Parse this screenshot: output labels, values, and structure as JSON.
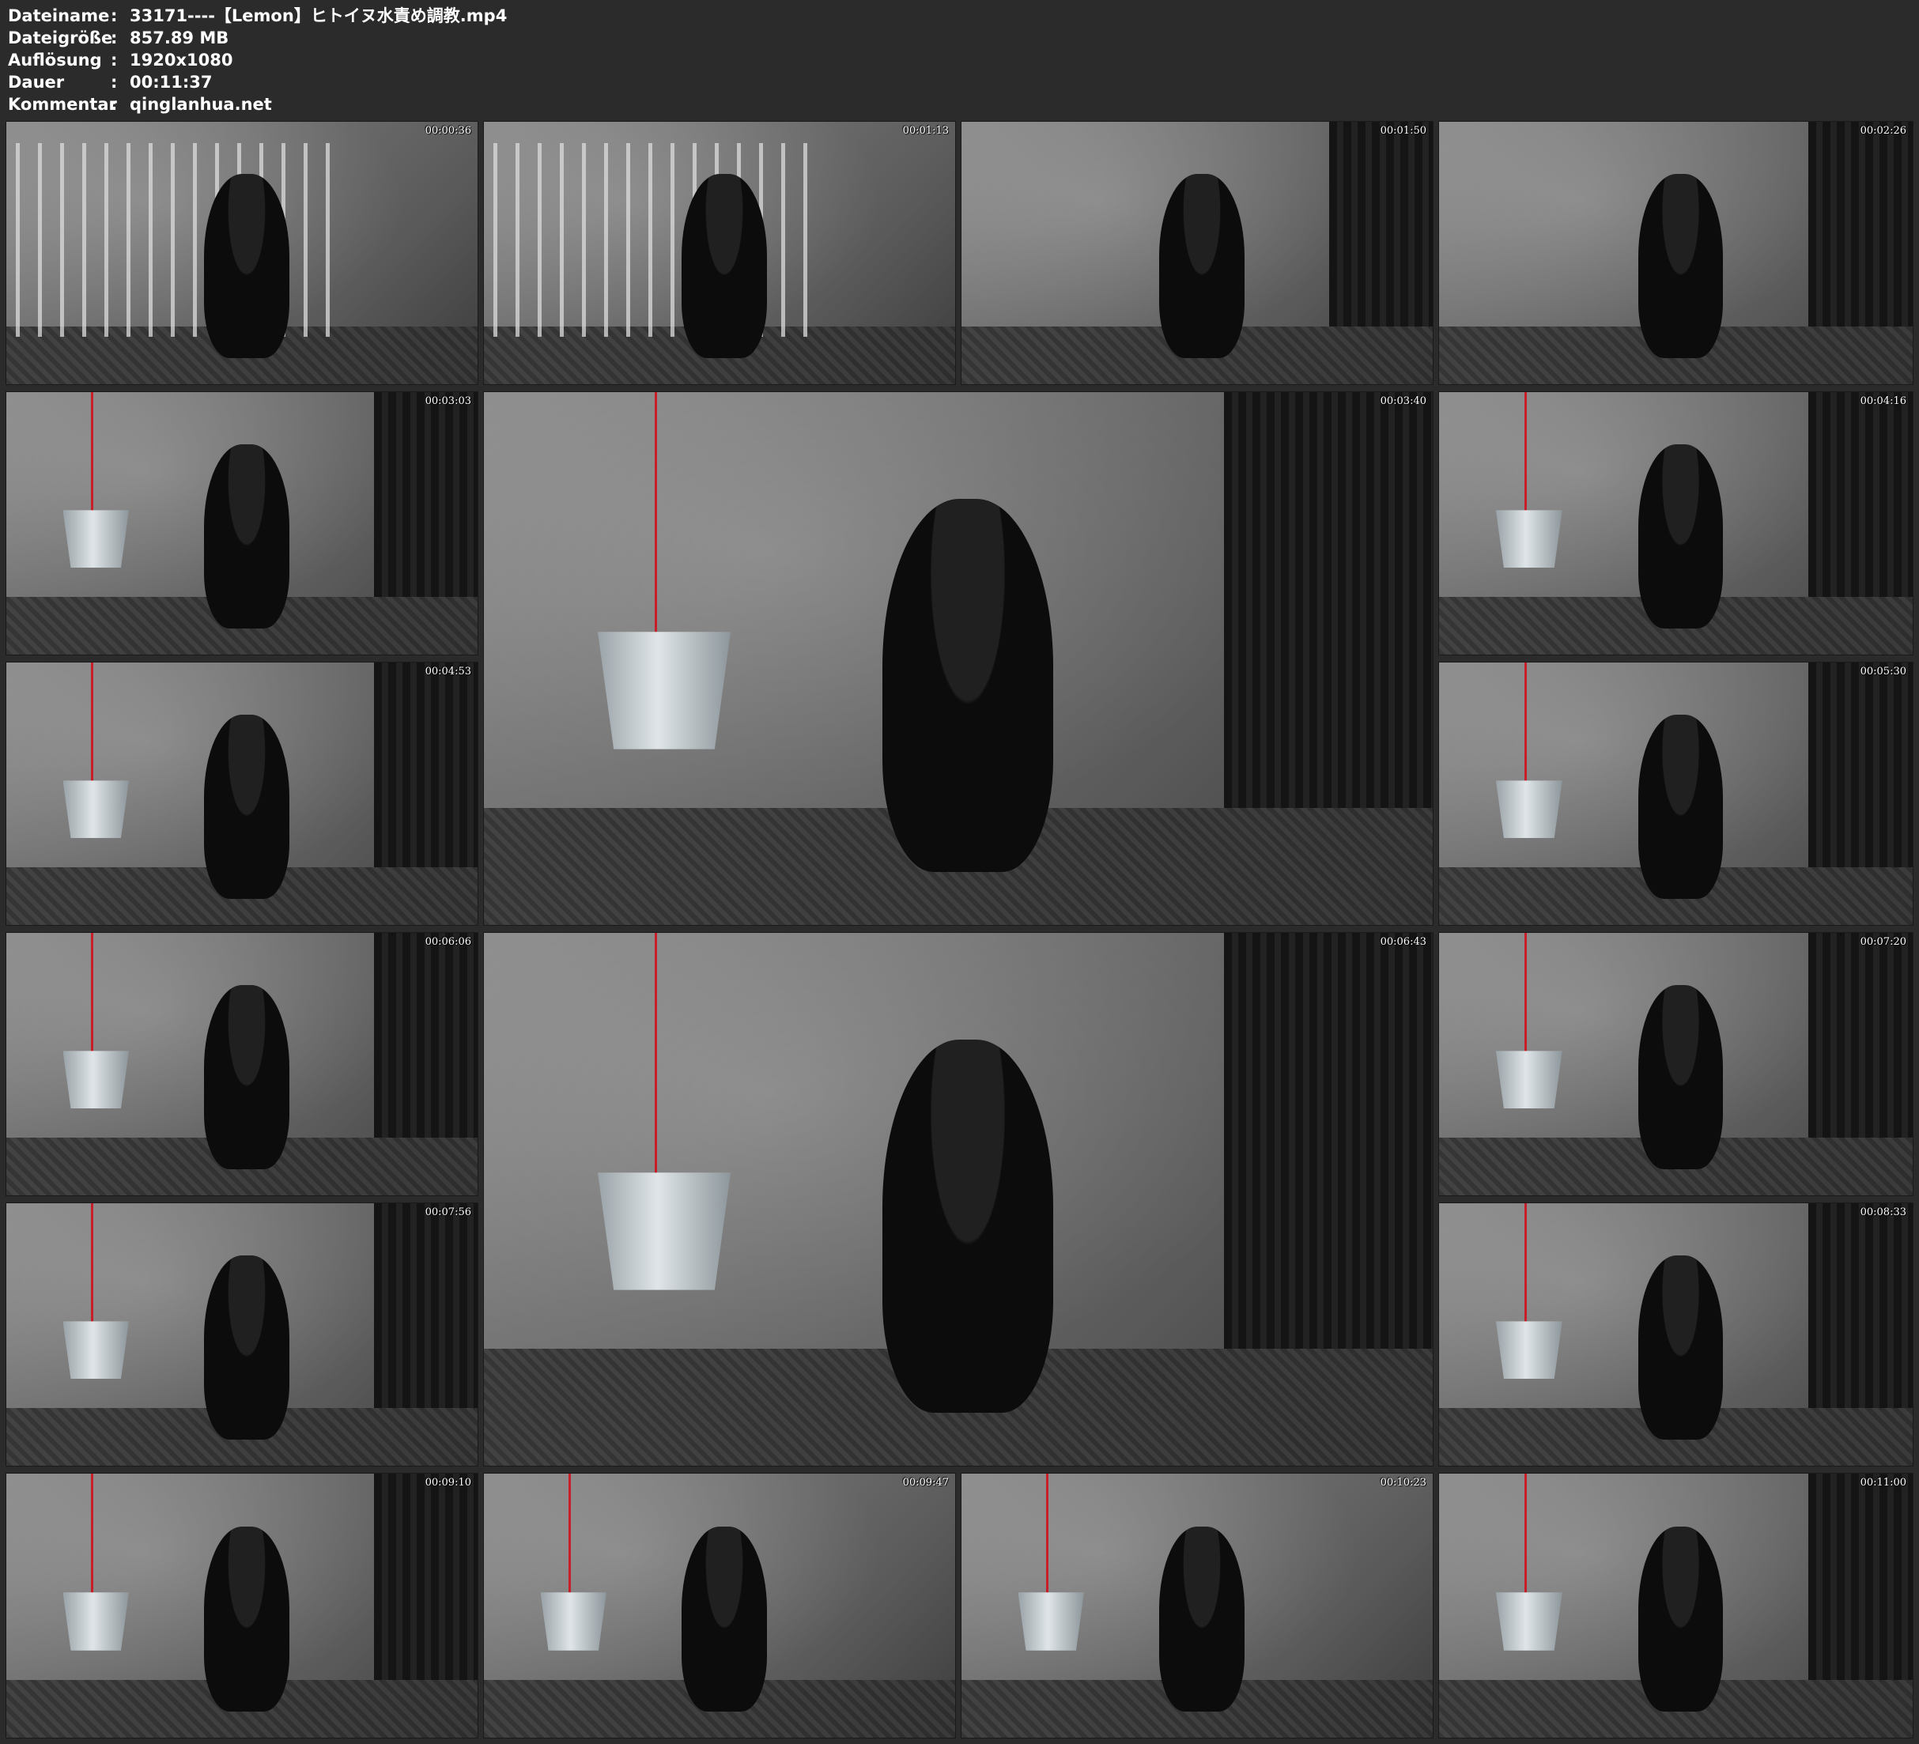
{
  "file_info": {
    "rows": [
      {
        "label": "Dateiname",
        "sep": ":",
        "value": "33171----【Lemon】ヒトイヌ水責め調教.mp4"
      },
      {
        "label": "Dateigröße",
        "sep": ":",
        "value": "857.89 MB"
      },
      {
        "label": "Auflösung",
        "sep": ":",
        "value": "1920x1080"
      },
      {
        "label": "Dauer",
        "sep": ":",
        "value": "00:11:37"
      },
      {
        "label": "Kommentar",
        "sep": ":",
        "value": "qinglanhua.net"
      }
    ]
  },
  "thumbnails": [
    {
      "timestamp": "00:00:36",
      "scene": "cage"
    },
    {
      "timestamp": "00:01:13",
      "scene": "cage"
    },
    {
      "timestamp": "00:01:50",
      "scene": "room"
    },
    {
      "timestamp": "00:02:26",
      "scene": "room"
    },
    {
      "timestamp": "00:03:03",
      "scene": "bucket"
    },
    {
      "timestamp": "00:03:40",
      "scene": "bucket"
    },
    {
      "timestamp": "00:04:16",
      "scene": "bucket"
    },
    {
      "timestamp": "00:04:53",
      "scene": "bucket"
    },
    {
      "timestamp": "00:05:30",
      "scene": "bucket"
    },
    {
      "timestamp": "00:06:06",
      "scene": "bucket"
    },
    {
      "timestamp": "00:06:43",
      "scene": "bucket"
    },
    {
      "timestamp": "00:07:20",
      "scene": "bucket"
    },
    {
      "timestamp": "00:07:56",
      "scene": "bucket"
    },
    {
      "timestamp": "00:08:33",
      "scene": "bucket"
    },
    {
      "timestamp": "00:09:10",
      "scene": "bucket"
    },
    {
      "timestamp": "00:09:47",
      "scene": "bucket"
    },
    {
      "timestamp": "00:10:23",
      "scene": "bucket"
    },
    {
      "timestamp": "00:11:00",
      "scene": "bucket"
    }
  ]
}
